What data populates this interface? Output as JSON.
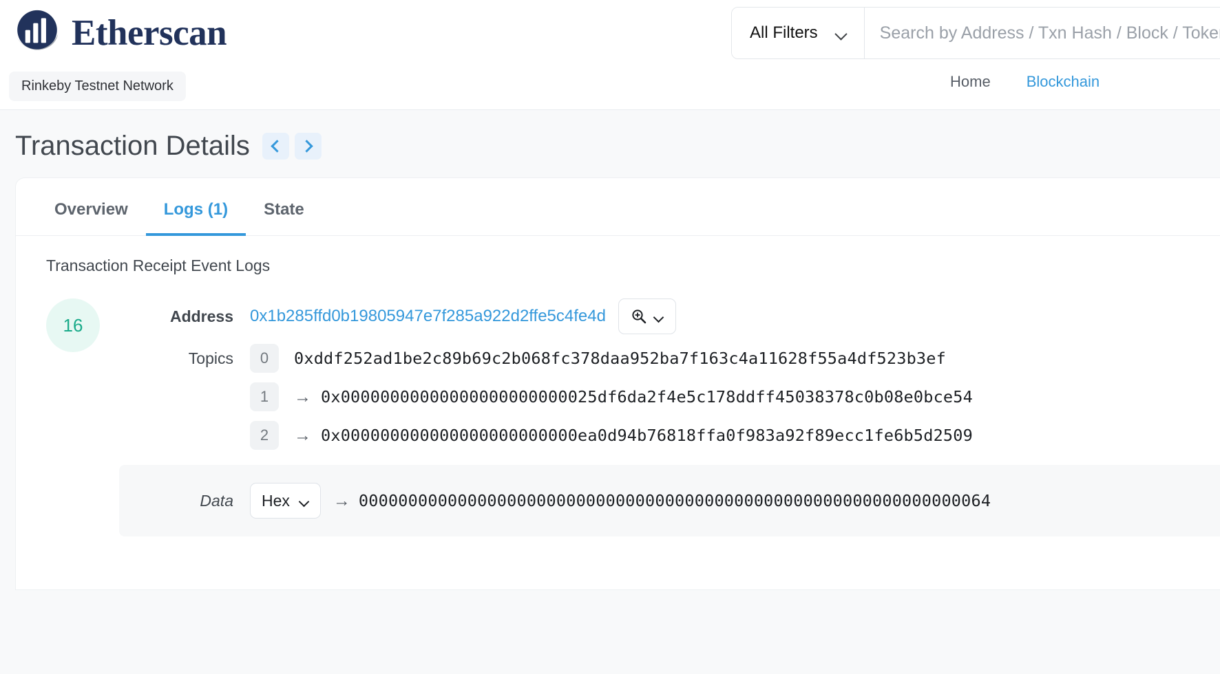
{
  "header": {
    "brand_name": "Etherscan",
    "network_badge": "Rinkeby Testnet Network",
    "search": {
      "filter_label": "All Filters",
      "placeholder": "Search by Address / Txn Hash / Block / Token / Ens",
      "value": ""
    },
    "nav": [
      {
        "label": "Home",
        "active": false
      },
      {
        "label": "Blockchain",
        "active": true
      }
    ]
  },
  "page": {
    "title": "Transaction Details",
    "prev_label": "‹",
    "next_label": "›"
  },
  "tabs": [
    {
      "label": "Overview",
      "active": false
    },
    {
      "label": "Logs (1)",
      "active": true
    },
    {
      "label": "State",
      "active": false
    }
  ],
  "logs": {
    "section_label": "Transaction Receipt Event Logs",
    "entry": {
      "index": "16",
      "address_label": "Address",
      "address_value": "0x1b285ffd0b19805947e7f285a922d2ffe5c4fe4d",
      "topics_label": "Topics",
      "topics": [
        {
          "index": "0",
          "arrow": "",
          "value": "0xddf252ad1be2c89b69c2b068fc378daa952ba7f163c4a11628f55a4df523b3ef"
        },
        {
          "index": "1",
          "arrow": "→",
          "value": "0x00000000000000000000000025df6da2f4e5c178ddff45038378c0b08e0bce54"
        },
        {
          "index": "2",
          "arrow": "→",
          "value": "0x000000000000000000000000ea0d94b76818ffa0f983a92f89ecc1fe6b5d2509"
        }
      ],
      "data_label": "Data",
      "data_format": "Hex",
      "data_arrow": "→",
      "data_value": "0000000000000000000000000000000000000000000000000000000000000064"
    }
  },
  "colors": {
    "brand_navy": "#21325b",
    "accent_blue": "#3498db",
    "index_green": "#1aab8a",
    "index_bg": "#e7f8f3"
  }
}
